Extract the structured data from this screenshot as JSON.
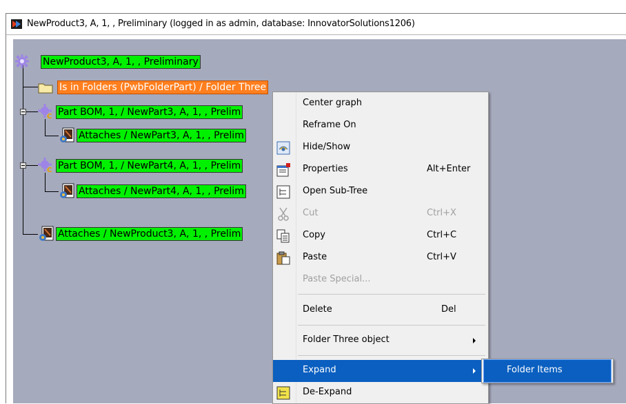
{
  "window": {
    "title": "NewProduct3, A, 1, , Preliminary (logged in as admin, database: InnovatorSolutions1206)"
  },
  "tree": {
    "root_label": "NewProduct3, A, 1, , Preliminary",
    "nodes": [
      {
        "label": "Is in Folders (PwbFolderPart) / Folder Three",
        "icon": "folder-icon"
      },
      {
        "label": "Part BOM, 1,  / NewPart3, A, 1, , Prelim",
        "icon": "gear-c-icon"
      },
      {
        "label": "Attaches / NewPart3, A, 1, , Prelim",
        "icon": "document-gear-icon"
      },
      {
        "label": "Part BOM, 1,  / NewPart4, A, 1, , Prelim",
        "icon": "gear-c-icon"
      },
      {
        "label": "Attaches / NewPart4, A, 1, , Prelim",
        "icon": "document-gear-icon"
      },
      {
        "label": "Attaches / NewProduct3, A, 1, , Prelim",
        "icon": "document-gear-icon"
      }
    ]
  },
  "context_menu": {
    "items": [
      {
        "label": "Center graph",
        "shortcut": "",
        "icon": ""
      },
      {
        "label": "Reframe On",
        "shortcut": "",
        "icon": ""
      },
      {
        "label": "Hide/Show",
        "shortcut": "",
        "icon": "hide-show-icon"
      },
      {
        "label": "Properties",
        "shortcut": "Alt+Enter",
        "icon": "properties-icon"
      },
      {
        "label": "Open Sub-Tree",
        "shortcut": "",
        "icon": "open-subtree-icon"
      },
      {
        "label": "Cut",
        "shortcut": "Ctrl+X",
        "icon": "scissors-icon",
        "disabled": true
      },
      {
        "label": "Copy",
        "shortcut": "Ctrl+C",
        "icon": "copy-icon"
      },
      {
        "label": "Paste",
        "shortcut": "Ctrl+V",
        "icon": "paste-icon"
      },
      {
        "label": "Paste Special...",
        "shortcut": "",
        "icon": "",
        "disabled": true
      },
      {
        "label": "Delete",
        "shortcut": "Del",
        "icon": ""
      },
      {
        "label": "Folder Three object",
        "shortcut": "",
        "icon": "",
        "submenu": true
      },
      {
        "label": "Expand",
        "shortcut": "",
        "icon": "",
        "submenu": true,
        "highlighted": true
      },
      {
        "label": "De-Expand",
        "shortcut": "",
        "icon": "de-expand-icon"
      }
    ]
  },
  "submenu": {
    "items": [
      {
        "label": "Folder Items",
        "highlighted": true
      }
    ]
  },
  "colors": {
    "canvas": "#a6aabd",
    "node_green": "#00f000",
    "node_orange": "#ff7f1e",
    "menu_highlight": "#0a5fc0"
  }
}
